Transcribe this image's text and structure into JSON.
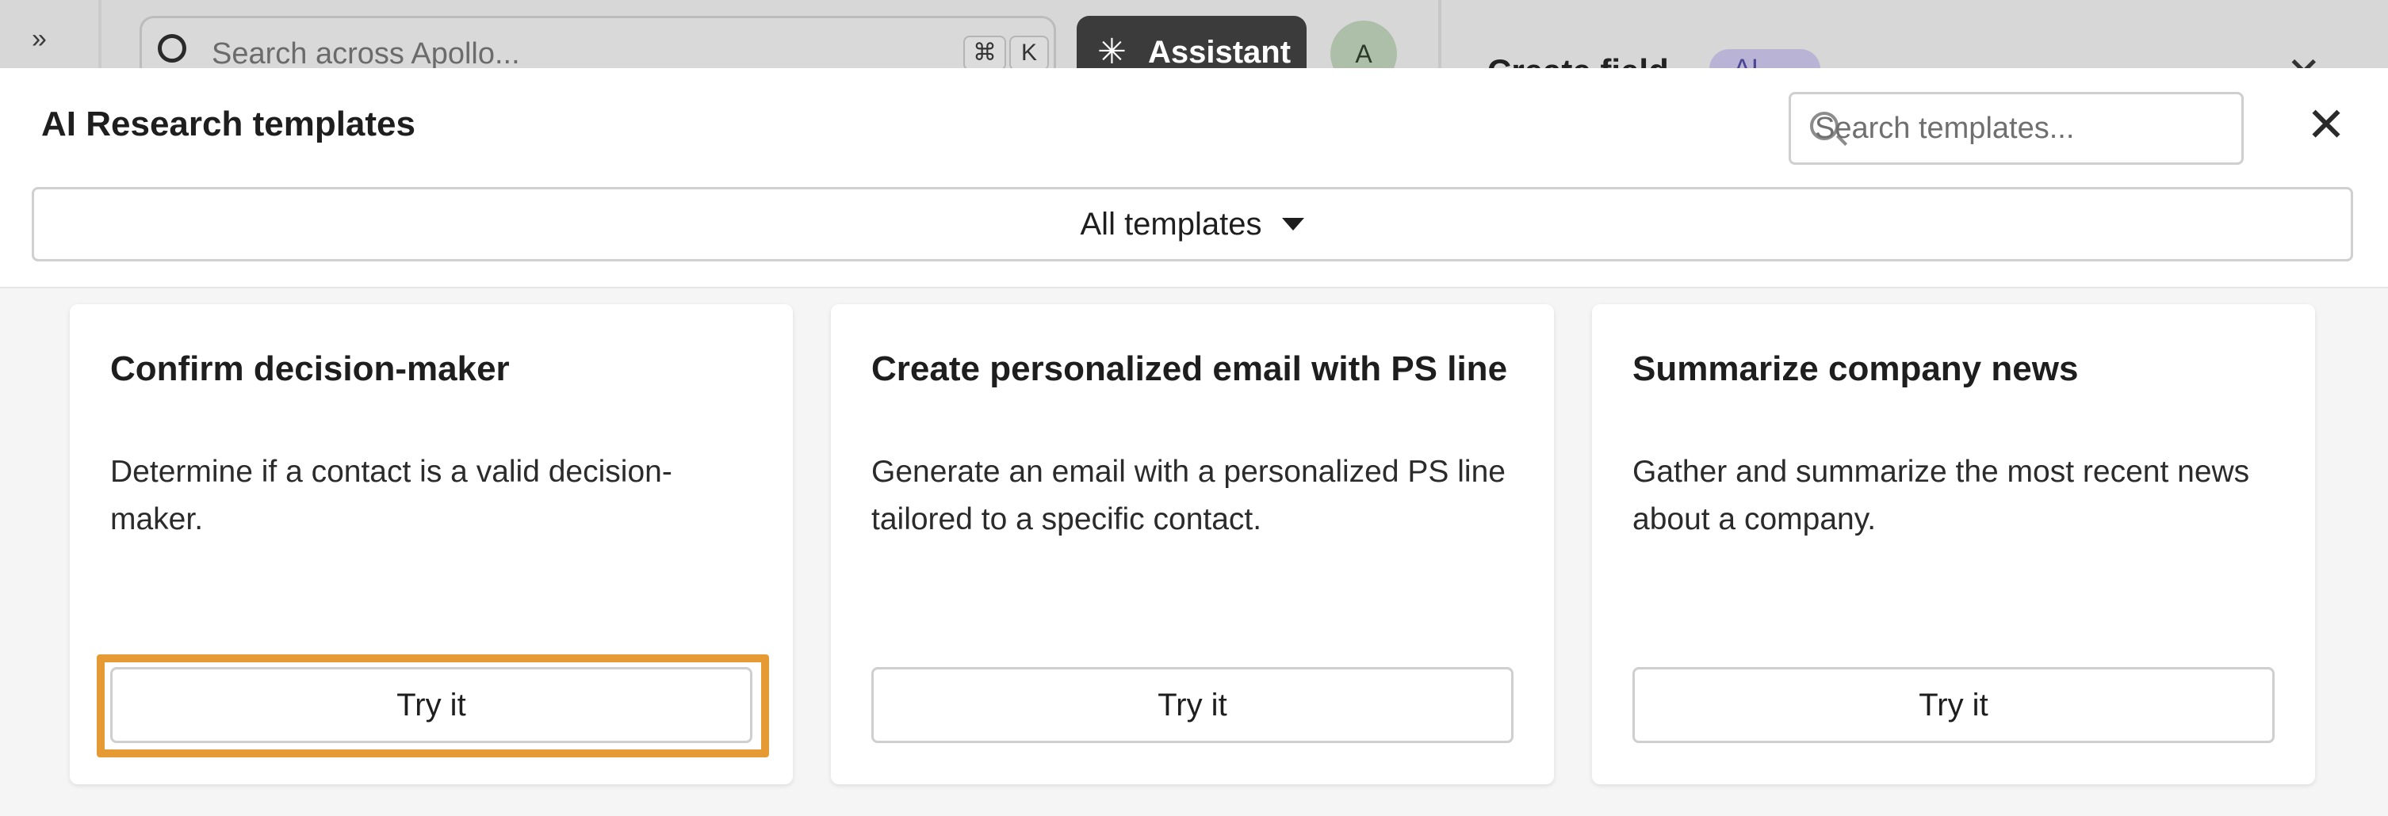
{
  "background": {
    "search_placeholder": "Search across Apollo...",
    "shortcut_keys": [
      "⌘",
      "K"
    ],
    "assistant_label": "Assistant",
    "avatar_initial": "A",
    "side_panel_title": "Create field",
    "side_panel_badge": "AI"
  },
  "modal": {
    "title": "AI Research templates",
    "search_placeholder": "Search templates...",
    "filter_label": "All templates"
  },
  "cards": [
    {
      "title": "Confirm decision-maker",
      "description": "Determine if a contact is a valid decision-maker.",
      "button_label": "Try it",
      "highlighted": true
    },
    {
      "title": "Create personalized email with PS line",
      "description": "Generate an email with a personalized PS line tailored to a specific contact.",
      "button_label": "Try it",
      "highlighted": false
    },
    {
      "title": "Summarize company news",
      "description": "Gather and summarize the most recent news about a company.",
      "button_label": "Try it",
      "highlighted": false
    }
  ],
  "colors": {
    "highlight": "#e69a33",
    "assistant_bg": "#3b3b3b",
    "ai_badge_bg": "#b9b4d6"
  }
}
